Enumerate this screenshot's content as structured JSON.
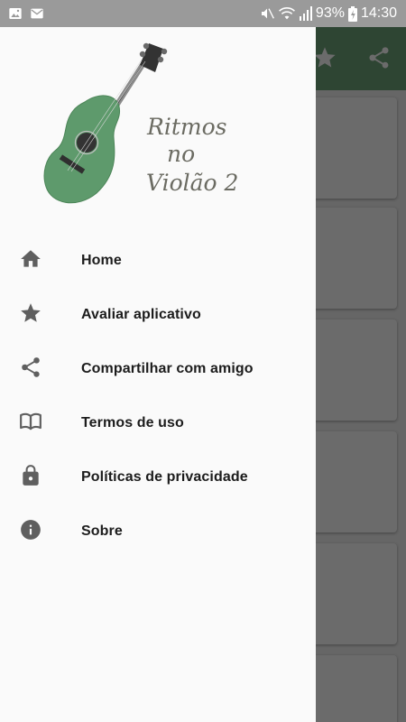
{
  "status_bar": {
    "battery": "93%",
    "time": "14:30",
    "left_icons": [
      "gallery-icon",
      "mail-icon"
    ],
    "right_icons": [
      "mute-icon",
      "wifi-icon",
      "signal-icon",
      "battery-icon"
    ]
  },
  "background_app": {
    "actions": [
      "star-icon",
      "share-icon"
    ]
  },
  "drawer": {
    "logo": {
      "line1": "Ritmos",
      "line2": "no",
      "line3": "Violão 2"
    },
    "items": [
      {
        "label": "Home",
        "icon": "home-icon"
      },
      {
        "label": "Avaliar aplicativo",
        "icon": "star-icon"
      },
      {
        "label": "Compartilhar com amigo",
        "icon": "share-icon"
      },
      {
        "label": "Termos de uso",
        "icon": "book-icon"
      },
      {
        "label": "Políticas de privacidade",
        "icon": "lock-icon"
      },
      {
        "label": "Sobre",
        "icon": "info-icon"
      }
    ]
  },
  "colors": {
    "guitar_body": "#5e9a6c",
    "logo_text": "#6b6b62",
    "icon": "#5f5f5f",
    "drawer_bg": "#fafafa"
  }
}
